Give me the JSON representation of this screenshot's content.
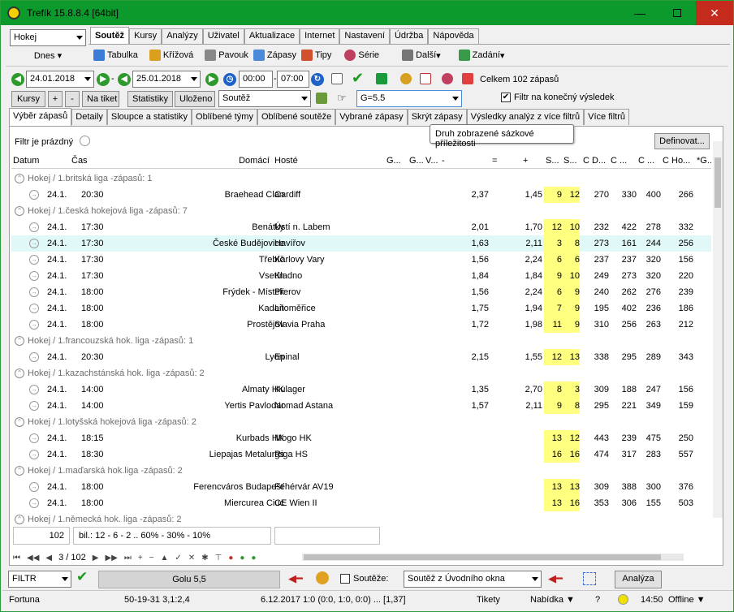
{
  "window": {
    "title": "Trefík 15.8.8.4 [64bit]"
  },
  "main_tabs": [
    "Soutěž",
    "Kursy",
    "Analýzy",
    "Uživatel",
    "Aktualizace",
    "Internet",
    "Nastavení",
    "Údržba",
    "Nápověda"
  ],
  "sport_select": "Hokej",
  "day_select": "Dnes",
  "toolbar": {
    "tabulka": "Tabulka",
    "krizova": "Křížová",
    "pavouk": "Pavouk",
    "zapasy": "Zápasy",
    "tipy": "Tipy",
    "serie": "Série",
    "dalsi": "Další",
    "zadani": "Zadání"
  },
  "filterbar": {
    "date_from": "24.01.2018",
    "date_to": "25.01.2018",
    "time_from": "00:00",
    "time_to": "07:00",
    "total": "Celkem 102 zápasů",
    "dash": "-"
  },
  "buttons": {
    "kursy": "Kursy",
    "plus": "+",
    "minus": "-",
    "na_tiket": "Na tiket",
    "statistiky": "Statistiky",
    "ulozeno": "Uloženo"
  },
  "sort_select": "Soutěž",
  "g_select": "G=5.5",
  "final_filter": "Filtr na konečný výsledek",
  "sub_tabs": [
    "Výběr zápasů",
    "Detaily",
    "Sloupce a statistiky",
    "Oblíbené týmy",
    "Oblíbené soutěže",
    "Vybrané zápasy",
    "Skrýt zápasy",
    "Výsledky analýz z více filtrů",
    "Více filtrů"
  ],
  "filter_status": "Filtr je prázdný",
  "define_button": "Definovat...",
  "tooltip": "Druh zobrazené sázkové příležitosti",
  "columns": [
    "Datum",
    "Čas",
    "Domácí",
    "Hosté",
    "G...",
    "G...",
    "V...",
    "-",
    "=",
    "+",
    "S...",
    "S...",
    "C D...",
    "C ...",
    "C ...",
    "C Ho...",
    "*G..."
  ],
  "rows": [
    {
      "g": "Hokej / 1.britská liga -zápasů: 1"
    },
    {
      "d": "24.1.",
      "t": "20:30",
      "h": "Braehead Clan",
      "a": "Cardiff",
      "m": "2,37",
      "p": "1,45",
      "s1": "9",
      "s2": "12",
      "c1": "270",
      "c2": "330",
      "c3": "400",
      "c4": "266"
    },
    {
      "g": "Hokej / 1.česká hokejová liga -zápasů: 7"
    },
    {
      "d": "24.1.",
      "t": "17:30",
      "h": "Benátky",
      "a": "Ústí n. Labem",
      "m": "2,01",
      "p": "1,70",
      "s1": "12",
      "s2": "10",
      "c1": "232",
      "c2": "422",
      "c3": "278",
      "c4": "332"
    },
    {
      "d": "24.1.",
      "t": "17:30",
      "h": "České Budějovice",
      "a": "Havířov",
      "m": "1,63",
      "p": "2,11",
      "s1": "3",
      "s2": "8",
      "c1": "273",
      "c2": "161",
      "c3": "244",
      "c4": "256",
      "sel": true
    },
    {
      "d": "24.1.",
      "t": "17:30",
      "h": "Třebíč",
      "a": "Karlovy Vary",
      "m": "1,56",
      "p": "2,24",
      "s1": "6",
      "s2": "6",
      "c1": "237",
      "c2": "237",
      "c3": "320",
      "c4": "156"
    },
    {
      "d": "24.1.",
      "t": "17:30",
      "h": "Vsetín",
      "a": "Kladno",
      "m": "1,84",
      "p": "1,84",
      "s1": "9",
      "s2": "10",
      "c1": "249",
      "c2": "273",
      "c3": "320",
      "c4": "220"
    },
    {
      "d": "24.1.",
      "t": "18:00",
      "h": "Frýdek - Místek",
      "a": "Přerov",
      "m": "1,56",
      "p": "2,24",
      "s1": "6",
      "s2": "9",
      "c1": "240",
      "c2": "262",
      "c3": "276",
      "c4": "239"
    },
    {
      "d": "24.1.",
      "t": "18:00",
      "h": "Kadaň",
      "a": "Litoměřice",
      "m": "1,75",
      "p": "1,94",
      "s1": "7",
      "s2": "9",
      "c1": "195",
      "c2": "402",
      "c3": "236",
      "c4": "186"
    },
    {
      "d": "24.1.",
      "t": "18:00",
      "h": "Prostějov",
      "a": "Slavia Praha",
      "m": "1,72",
      "p": "1,98",
      "s1": "11",
      "s2": "9",
      "c1": "310",
      "c2": "256",
      "c3": "263",
      "c4": "212"
    },
    {
      "g": "Hokej / 1.francouzská hok. liga -zápasů: 1"
    },
    {
      "d": "24.1.",
      "t": "20:30",
      "h": "Lyon",
      "a": "Epinal",
      "m": "2,15",
      "p": "1,55",
      "s1": "12",
      "s2": "13",
      "c1": "338",
      "c2": "295",
      "c3": "289",
      "c4": "343"
    },
    {
      "g": "Hokej / 1.kazachstánská hok. liga -zápasů: 2"
    },
    {
      "d": "24.1.",
      "t": "14:00",
      "h": "Almaty HK",
      "a": "Kulager",
      "m": "1,35",
      "p": "2,70",
      "s1": "8",
      "s2": "3",
      "c1": "309",
      "c2": "188",
      "c3": "247",
      "c4": "156"
    },
    {
      "d": "24.1.",
      "t": "14:00",
      "h": "Yertis Pavlodar",
      "a": "Nomad Astana",
      "m": "1,57",
      "p": "2,11",
      "s1": "9",
      "s2": "8",
      "c1": "295",
      "c2": "221",
      "c3": "349",
      "c4": "159"
    },
    {
      "g": "Hokej / 1.lotyšská hokejová liga -zápasů: 2"
    },
    {
      "d": "24.1.",
      "t": "18:15",
      "h": "Kurbads HK",
      "a": "Mogo HK",
      "m": "",
      "p": "",
      "s1": "13",
      "s2": "12",
      "c1": "443",
      "c2": "239",
      "c3": "475",
      "c4": "250"
    },
    {
      "d": "24.1.",
      "t": "18:30",
      "h": "Liepajas Metalurgs",
      "a": "Riga HS",
      "m": "",
      "p": "",
      "s1": "16",
      "s2": "16",
      "c1": "474",
      "c2": "317",
      "c3": "283",
      "c4": "557"
    },
    {
      "g": "Hokej / 1.maďarská hok.liga -zápasů: 2"
    },
    {
      "d": "24.1.",
      "t": "18:00",
      "h": "Ferencváros Budapešť",
      "a": "Fehérvár AV19",
      "m": "",
      "p": "",
      "s1": "13",
      "s2": "13",
      "c1": "309",
      "c2": "388",
      "c3": "300",
      "c4": "376"
    },
    {
      "d": "24.1.",
      "t": "18:00",
      "h": "Miercurea Ciuc",
      "a": "CE Wien II",
      "m": "",
      "p": "",
      "s1": "13",
      "s2": "16",
      "c1": "353",
      "c2": "306",
      "c3": "155",
      "c4": "503"
    },
    {
      "g": "Hokej / 1.německá hok. liga -zápasů: 2"
    }
  ],
  "summary": {
    "count": "102",
    "bil": "bil.: 12 - 6 - 2 .. 60% - 30% - 10%"
  },
  "nav": {
    "pos": "3 / 102"
  },
  "bottom": {
    "filtr": "FILTR",
    "golu": "Golu 5,5",
    "soutez_label": "Soutěže:",
    "soutez_select": "Soutěž z Úvodního okna",
    "analyza": "Analýza"
  },
  "status": {
    "bookmaker": "Fortuna",
    "code": "50-19-31 3,1:2,4",
    "match": "6.12.2017 1:0 (0:0, 1:0, 0:0) ... [1,37]",
    "tikety": "Tikety",
    "nabidka": "Nabídka",
    "q": "?",
    "time": "14:50",
    "offline": "Offline"
  }
}
